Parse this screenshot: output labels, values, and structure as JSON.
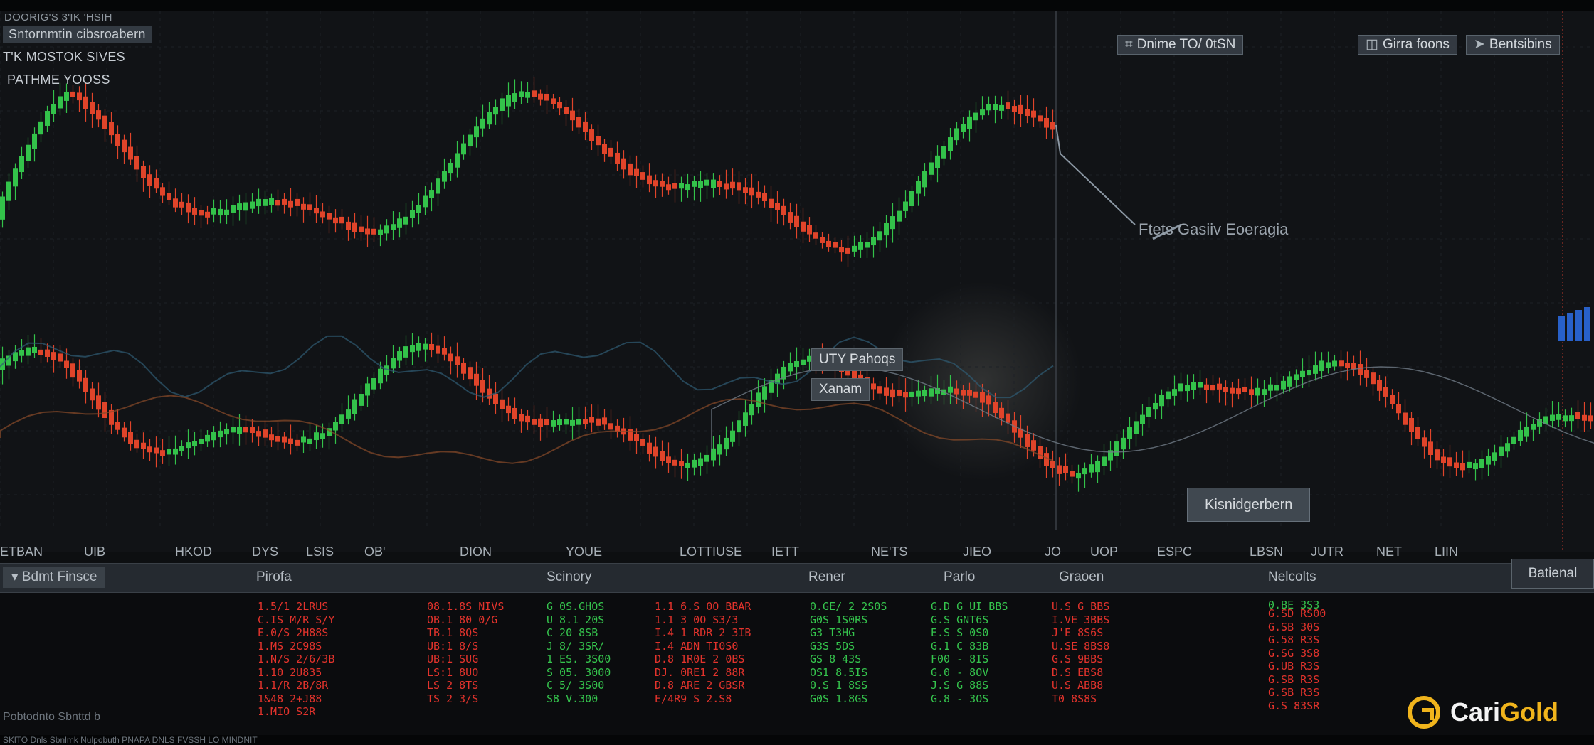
{
  "window": {
    "header_lines": [
      "DOORIG'S 3'IK 'HSIH",
      "Sntornmtin cibsroabern",
      "T'K MOSTOK SIVES",
      "PATHME YOOSS"
    ]
  },
  "toolbar": {
    "timeframe_label": "Dnime TO/ 0tSN",
    "zoom_label": "Girra foons",
    "settings_label": "Bentsibins"
  },
  "annotations": {
    "divergence": "Ftets Gasiiv Eoeragia",
    "patterns_tag": "UTY Pahoqs",
    "alarm_tag": "Xanam",
    "kidder_tag": "Kisnidgerbern"
  },
  "x_axis": {
    "ticks": [
      "ETBAN",
      "UIB",
      "HKOD",
      "DYS",
      "LSIS",
      "OB'",
      "DION",
      "YOUE",
      "LOTTIUSE",
      "IETT",
      "NE'TS",
      "JIEO",
      "JO",
      "UOP",
      "ESPC",
      "LBSN",
      "JUTR",
      "NET",
      "LIIN"
    ]
  },
  "table": {
    "headers": [
      "Bdmt Finsce",
      "Pirofa",
      "Scinory",
      "Rener",
      "Parlo",
      "Graoen",
      "Nelcolts"
    ],
    "external_button": "Batienal",
    "columns": [
      {
        "color": "red",
        "cells": [
          "1.5/1 2LRUS",
          "C.IS M/R S/Y",
          "E.0/S 2H88S",
          "1.MS 2C98S",
          "1.N/S 2/6/3B",
          "1.10 2U835",
          "1.1/R 2B/8R",
          "1&48 2+J88",
          "1.MIO S2R"
        ]
      },
      {
        "color": "red",
        "cells": [
          "08.1.8S NIVS",
          "OB.1 80 0/G",
          "TB.1 8QS",
          "UB:1 8/S",
          "UB:1 SUG",
          "LS:1 8UO",
          "LS 2 8TS",
          "TS 2 3/S"
        ]
      },
      {
        "color": "green",
        "cells": [
          "G 0S.GHOS",
          "U 8.1 20S",
          "C 20 8SB",
          "J 8/ 3SR/",
          "1 ES. 3S00",
          "S 05. 3000",
          "C 5/ 3S00",
          "S8 V.300"
        ]
      },
      {
        "color": "red",
        "cells": [
          "1.1 6.S 0O BBAR",
          "1.1 3 0O S3/3",
          "I.4 1 RDR 2 3IB",
          "I.4 ADN TI0S0",
          "D.8 1R0E 2 0BS",
          "DJ. 0RE1 2 88R",
          "D.8 ARE 2 GBSR",
          "E/4R9 S 2.S8"
        ]
      },
      {
        "color": "green",
        "cells": [
          "0.GE/ 2 2S0S",
          "G0S 1S0RS",
          "G3 T3HG",
          "G3S 5DS",
          "GS 8 43S",
          "OS1 8.5IS",
          "0.S 1 8SS",
          "G0S 1.8GS"
        ]
      },
      {
        "color": "green",
        "cells": [
          "G.D G UI BBS",
          "G.S GNT6S",
          "E.S S 0S0",
          "G.1 C 83B",
          "F00 - 8IS",
          "G.0 - 8OV",
          "J.S G 88S",
          "G.8 - 3OS"
        ]
      },
      {
        "color": "red",
        "cells": [
          "U.S G BBS",
          "I.VE 3BBS",
          "J'E 8S6S",
          "U.SE 8BS8",
          "G.S 9BBS",
          "D.S EBS8",
          "U.S ABB8",
          "T0 8S8S"
        ]
      },
      {
        "color": "green",
        "cells": [
          "0.BE 3S3"
        ]
      },
      {
        "color": "red",
        "cells": [
          "G.SD RS00",
          "G.SB 30S",
          "G.58 R3S",
          "G.SG 3S8",
          "G.UB R3S",
          "G.SB R3S",
          "G.SB R3S",
          "G.S 83SR"
        ]
      }
    ]
  },
  "footer": {
    "line1": "Pobtodnto Sbnttd b",
    "line2": "SKlTO Dnls Sbnlmk Nulpobuth PNAPA DNLS FVSSH LO MINDNIT"
  },
  "brand": {
    "name_part1": "Cari",
    "name_part2": "Gold"
  },
  "colors": {
    "up": "#33c24a",
    "down": "#e0442a",
    "accent_gold": "#f0b41c",
    "panel": "#252a30",
    "background": "#111316"
  }
}
